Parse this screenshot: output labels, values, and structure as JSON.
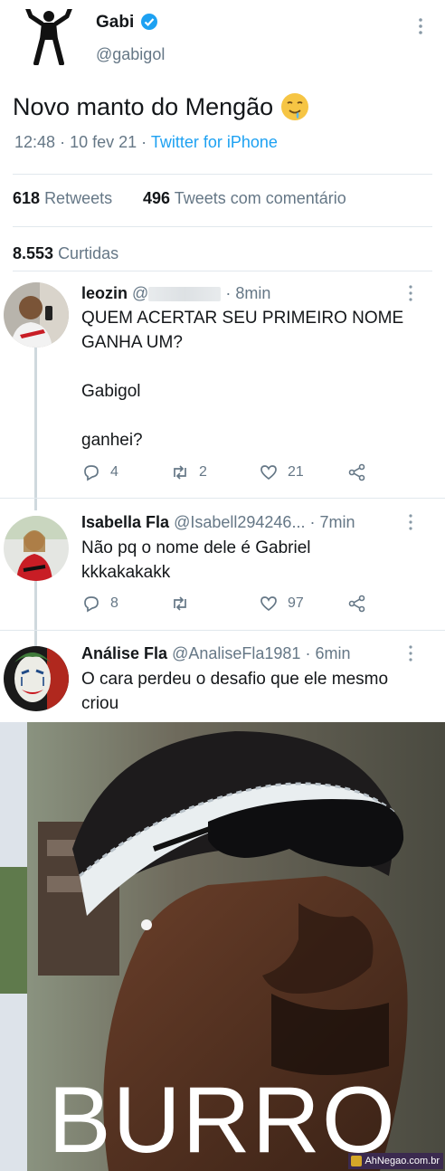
{
  "tweet": {
    "author_name": "Gabi",
    "author_handle": "@gabigol",
    "text": "Novo manto do Mengão",
    "emoji_icon": "drooling-face-emoji",
    "time": "12:48",
    "date": "10 fev 21",
    "source": "Twitter for iPhone",
    "retweets_count": "618",
    "retweets_label": "Retweets",
    "quotes_count": "496",
    "quotes_label": "Tweets com comentário",
    "likes_count": "8.553",
    "likes_label": "Curtidas"
  },
  "replies": [
    {
      "name": "leozin",
      "handle_prefix": "@",
      "time": "8min",
      "lines": [
        "QUEM ACERTAR SEU PRIMEIRO NOME",
        "GANHA UM?",
        "",
        "Gabigol",
        "",
        "ganhei?"
      ],
      "replies_count": "4",
      "retweets_count": "2",
      "likes_count": "21"
    },
    {
      "name": "Isabella Fla",
      "handle": "@Isabell294246...",
      "time": "7min",
      "lines": [
        "Não pq o nome dele é Gabriel",
        "kkkakakakk"
      ],
      "replies_count": "8",
      "retweets_count": "",
      "likes_count": "97"
    },
    {
      "name": "Análise Fla",
      "handle": "@AnaliseFla1981",
      "time": "6min",
      "lines": [
        "O cara perdeu o desafio que ele mesmo",
        "criou"
      ]
    }
  ],
  "meme": {
    "caption": "BURRO",
    "watermark": "AhNegao.com.br"
  },
  "colors": {
    "link": "#1da1f2",
    "secondary_text": "#657786",
    "verified": "#1da1f2"
  }
}
